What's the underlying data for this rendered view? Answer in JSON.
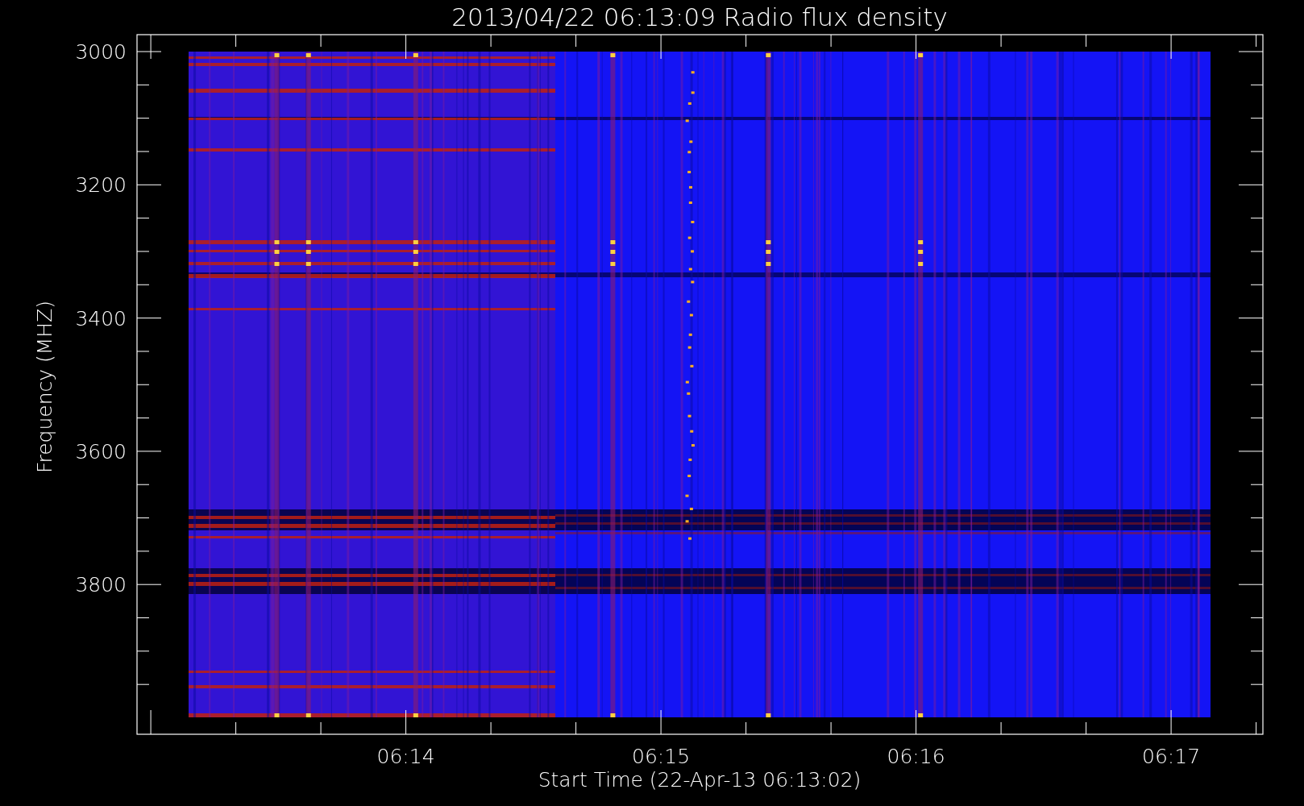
{
  "title": "2013/04/22 06:13:09 Radio flux density",
  "y_axis": {
    "label": "Frequency (MHZ)",
    "ticks": [
      "3000",
      "3200",
      "3400",
      "3600",
      "3800"
    ]
  },
  "x_axis": {
    "label": "Start Time (22-Apr-13 06:13:02)",
    "ticks": [
      "06:14",
      "06:15",
      "06:16",
      "06:17"
    ]
  }
}
